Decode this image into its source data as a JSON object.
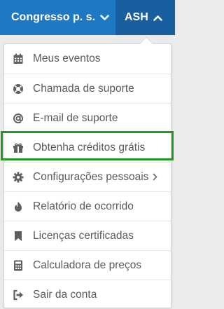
{
  "header": {
    "org_label": "Congresso p. s.",
    "user_label": "ASH",
    "bg_color": "#1f78c4",
    "active_bg_color": "#175f9f"
  },
  "menu": {
    "items": [
      {
        "label": "Meus eventos",
        "icon": "calendar-icon"
      },
      {
        "label": "Chamada de suporte",
        "icon": "lifebuoy-icon"
      },
      {
        "label": "E-mail de suporte",
        "icon": "at-sign-icon"
      },
      {
        "label": "Obtenha créditos grátis",
        "icon": "gift-icon",
        "highlighted": true
      },
      {
        "label": "Configurações pessoais",
        "icon": "gear-icon",
        "has_submenu": true
      },
      {
        "label": "Relatório de ocorrido",
        "icon": "fire-icon"
      },
      {
        "label": "Licenças certificadas",
        "icon": "bookmark-icon"
      },
      {
        "label": "Calculadora de preços",
        "icon": "calculator-icon"
      },
      {
        "label": "Sair da conta",
        "icon": "sign-out-icon"
      }
    ],
    "highlight_color": "#1f9a1f"
  }
}
